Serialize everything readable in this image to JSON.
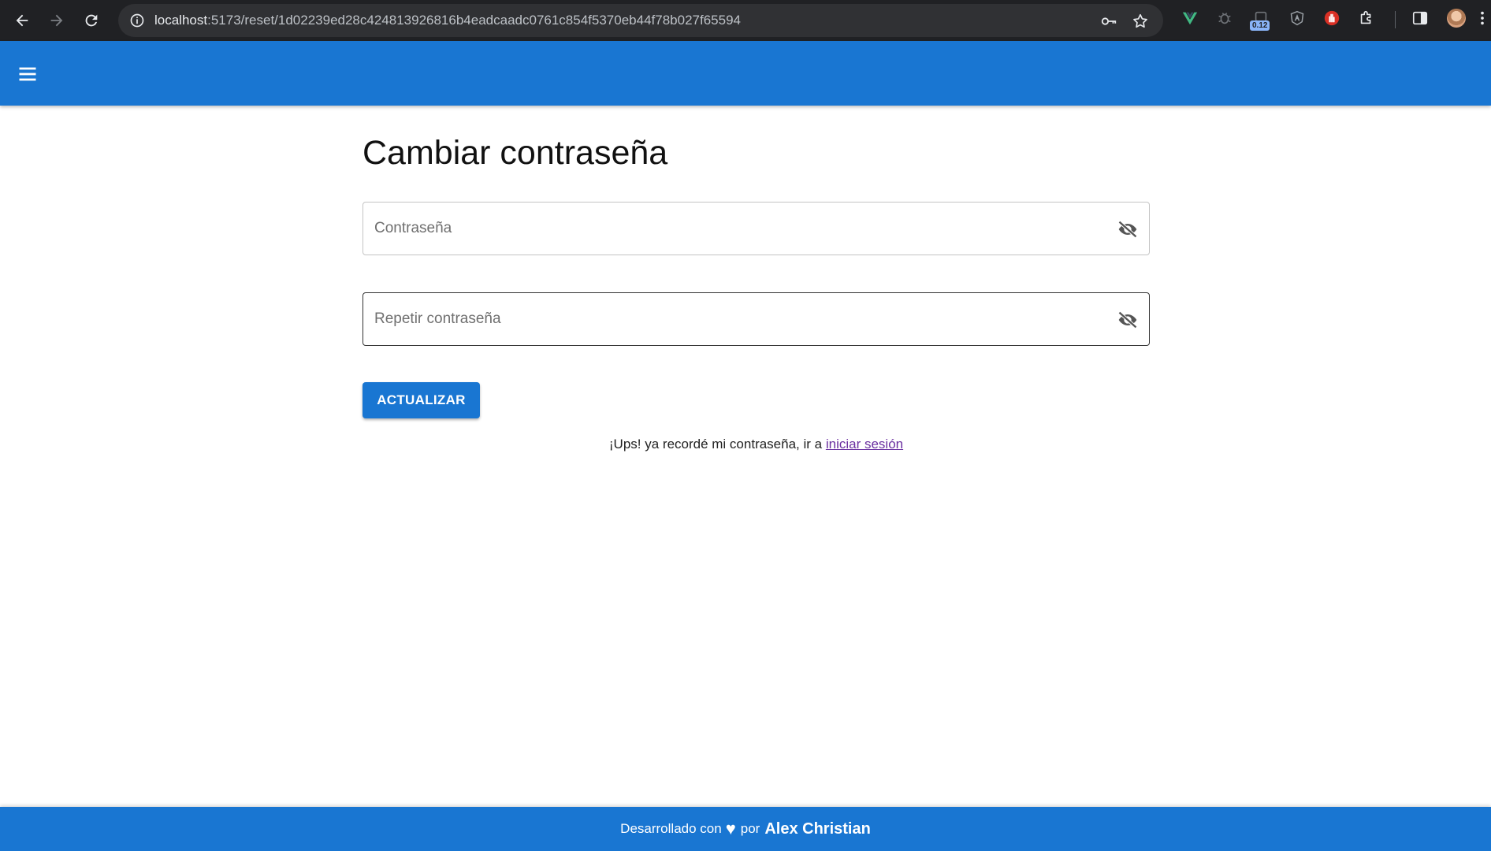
{
  "browser": {
    "url_host": "localhost",
    "url_path": ":5173/reset/1d02239ed28c424813926816b4eadcaadc0761c854f5370eb44f78b027f65594",
    "extension_badge": "0.12",
    "icons": [
      "back-arrow-icon",
      "forward-arrow-icon",
      "reload-icon",
      "site-info-icon",
      "password-key-icon",
      "bookmark-star-icon",
      "vue-devtools-icon",
      "bug-extension-icon",
      "timer-extension-icon",
      "angular-extension-icon",
      "stop-hand-extension-icon",
      "extensions-puzzle-icon",
      "side-panel-icon",
      "profile-avatar",
      "more-menu-icon"
    ]
  },
  "header": {
    "menu_icon": "hamburger-menu-icon",
    "color": "#1976d2"
  },
  "form": {
    "title": "Cambiar contraseña",
    "password_placeholder": "Contraseña",
    "repeat_placeholder": "Repetir contraseña",
    "visibility_icon": "eye-off-icon",
    "submit_label": "ACTUALIZAR"
  },
  "hint": {
    "text": "¡Ups! ya recordé mi contraseña, ir a ",
    "link": "iniciar sesión"
  },
  "footer": {
    "prefix": "Desarrollado con",
    "heart": "♥",
    "by": "por",
    "author": "Alex Christian"
  }
}
